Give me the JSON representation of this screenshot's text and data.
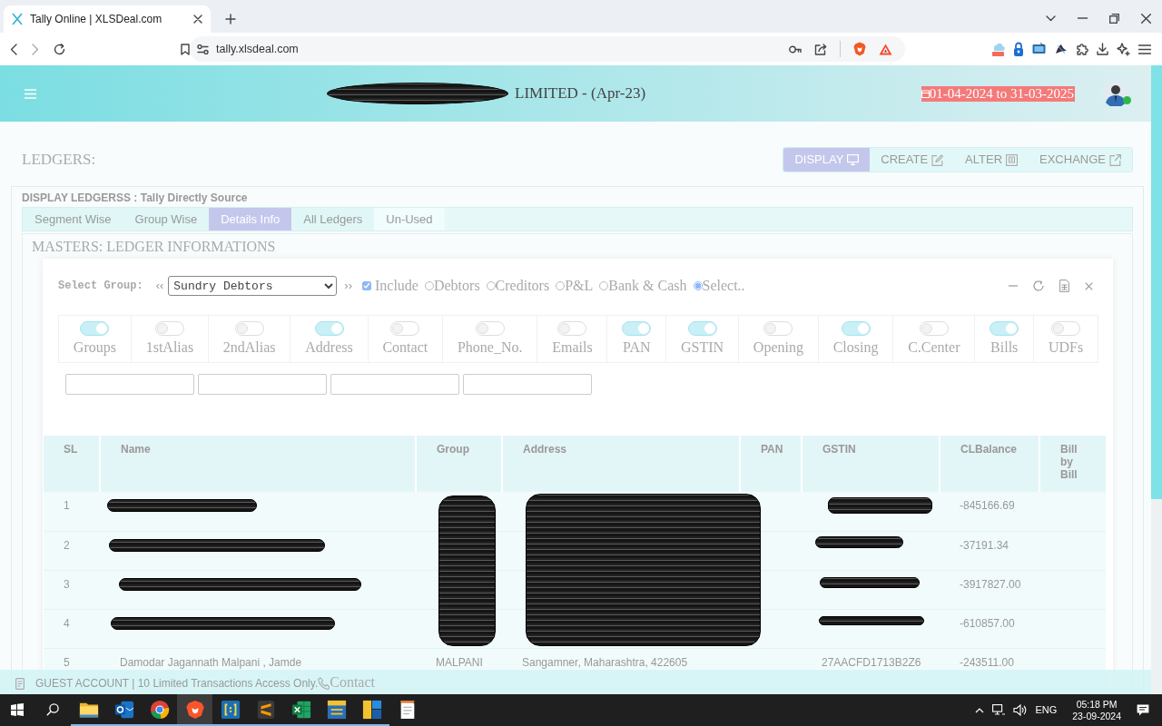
{
  "browser": {
    "tab": {
      "title": "Tally Online | XLSDeal.com"
    },
    "url": "tally.xlsdeal.com"
  },
  "header": {
    "company_redacted": true,
    "title": "LIMITED - (Apr-23)",
    "period": "01-04-2024 to 31-03-2025",
    "user_online": true
  },
  "page": {
    "title": "LEDGERS:",
    "actions": [
      {
        "label": "DISPLAY",
        "kind": "display",
        "selected": true
      },
      {
        "label": "CREATE",
        "kind": "create",
        "selected": false
      },
      {
        "label": "ALTER",
        "kind": "alter",
        "selected": false
      },
      {
        "label": "EXCHANGE",
        "kind": "exchange",
        "selected": false
      }
    ]
  },
  "panel": {
    "title": "DISPLAY LEDGERSS : Tally Directly Source",
    "tabs": [
      {
        "label": "Segment Wise",
        "selected": false
      },
      {
        "label": "Group Wise",
        "selected": false
      },
      {
        "label": "Details Info",
        "selected": true
      },
      {
        "label": "All Ledgers",
        "selected": false
      },
      {
        "label": "Un-Used",
        "selected": false
      }
    ],
    "section_title": "MASTERS: LEDGER INFORMATIONS"
  },
  "filter": {
    "label": "Select Group:",
    "prev": "‹‹",
    "group": "Sundry Debtors",
    "next": "››",
    "include": {
      "label": "Include",
      "checked": true
    },
    "options": [
      {
        "label": "Debtors",
        "selected": false
      },
      {
        "label": "Creditors",
        "selected": false
      },
      {
        "label": "P&L",
        "selected": false
      },
      {
        "label": "Bank & Cash",
        "selected": false
      },
      {
        "label": "Select..",
        "selected": true
      }
    ]
  },
  "column_toggles": [
    {
      "label": "Groups",
      "on": true
    },
    {
      "label": "1stAlias",
      "on": false
    },
    {
      "label": "2ndAlias",
      "on": false
    },
    {
      "label": "Address",
      "on": true
    },
    {
      "label": "Contact",
      "on": false
    },
    {
      "label": "Phone_No.",
      "on": false
    },
    {
      "label": "Emails",
      "on": false
    },
    {
      "label": "PAN",
      "on": true
    },
    {
      "label": "GSTIN",
      "on": true
    },
    {
      "label": "Opening",
      "on": false
    },
    {
      "label": "Closing",
      "on": true
    },
    {
      "label": "C.Center",
      "on": false
    },
    {
      "label": "Bills",
      "on": true
    },
    {
      "label": "UDFs",
      "on": false
    }
  ],
  "table": {
    "columns": [
      "SL",
      "Name",
      "Group",
      "Address",
      "PAN",
      "GSTIN",
      "CLBalance",
      "Bill by Bill"
    ],
    "rows": [
      {
        "sl": "1",
        "redacted": true,
        "cl_balance": "-845166.69"
      },
      {
        "sl": "2",
        "redacted": true,
        "cl_balance": "-37191.34"
      },
      {
        "sl": "3",
        "redacted": true,
        "cl_balance": "-3917827.00"
      },
      {
        "sl": "4",
        "redacted": true,
        "cl_balance": "-610857.00"
      },
      {
        "sl": "5",
        "redacted": false,
        "name": "Damodar Jagannath Malpani , Jamde",
        "group": "MALPANI",
        "address": "Sangamner, Maharashtra, 422605",
        "gstin": "27AACFD1713B2Z6",
        "cl_balance": "-243511.00"
      }
    ]
  },
  "footer": {
    "text": "GUEST ACCOUNT | 10 Limited Transactions Access Only.",
    "contact": "Contact"
  },
  "taskbar": {
    "apps": [
      {
        "kind": "explorer",
        "running": true,
        "selected": false
      },
      {
        "kind": "mail",
        "running": true,
        "selected": false
      },
      {
        "kind": "chrome",
        "running": true,
        "selected": false
      },
      {
        "kind": "brave",
        "running": true,
        "selected": true
      },
      {
        "kind": "brackets",
        "running": true,
        "selected": false
      },
      {
        "kind": "sublime",
        "running": true,
        "selected": false
      },
      {
        "kind": "excel",
        "running": true,
        "selected": false
      },
      {
        "kind": "el",
        "running": true,
        "selected": false
      },
      {
        "kind": "tiles",
        "running": true,
        "selected": false
      },
      {
        "kind": "notepad",
        "running": false,
        "selected": false
      }
    ],
    "language": "ENG",
    "time": "05:18 PM",
    "date": "23-09-2024"
  }
}
